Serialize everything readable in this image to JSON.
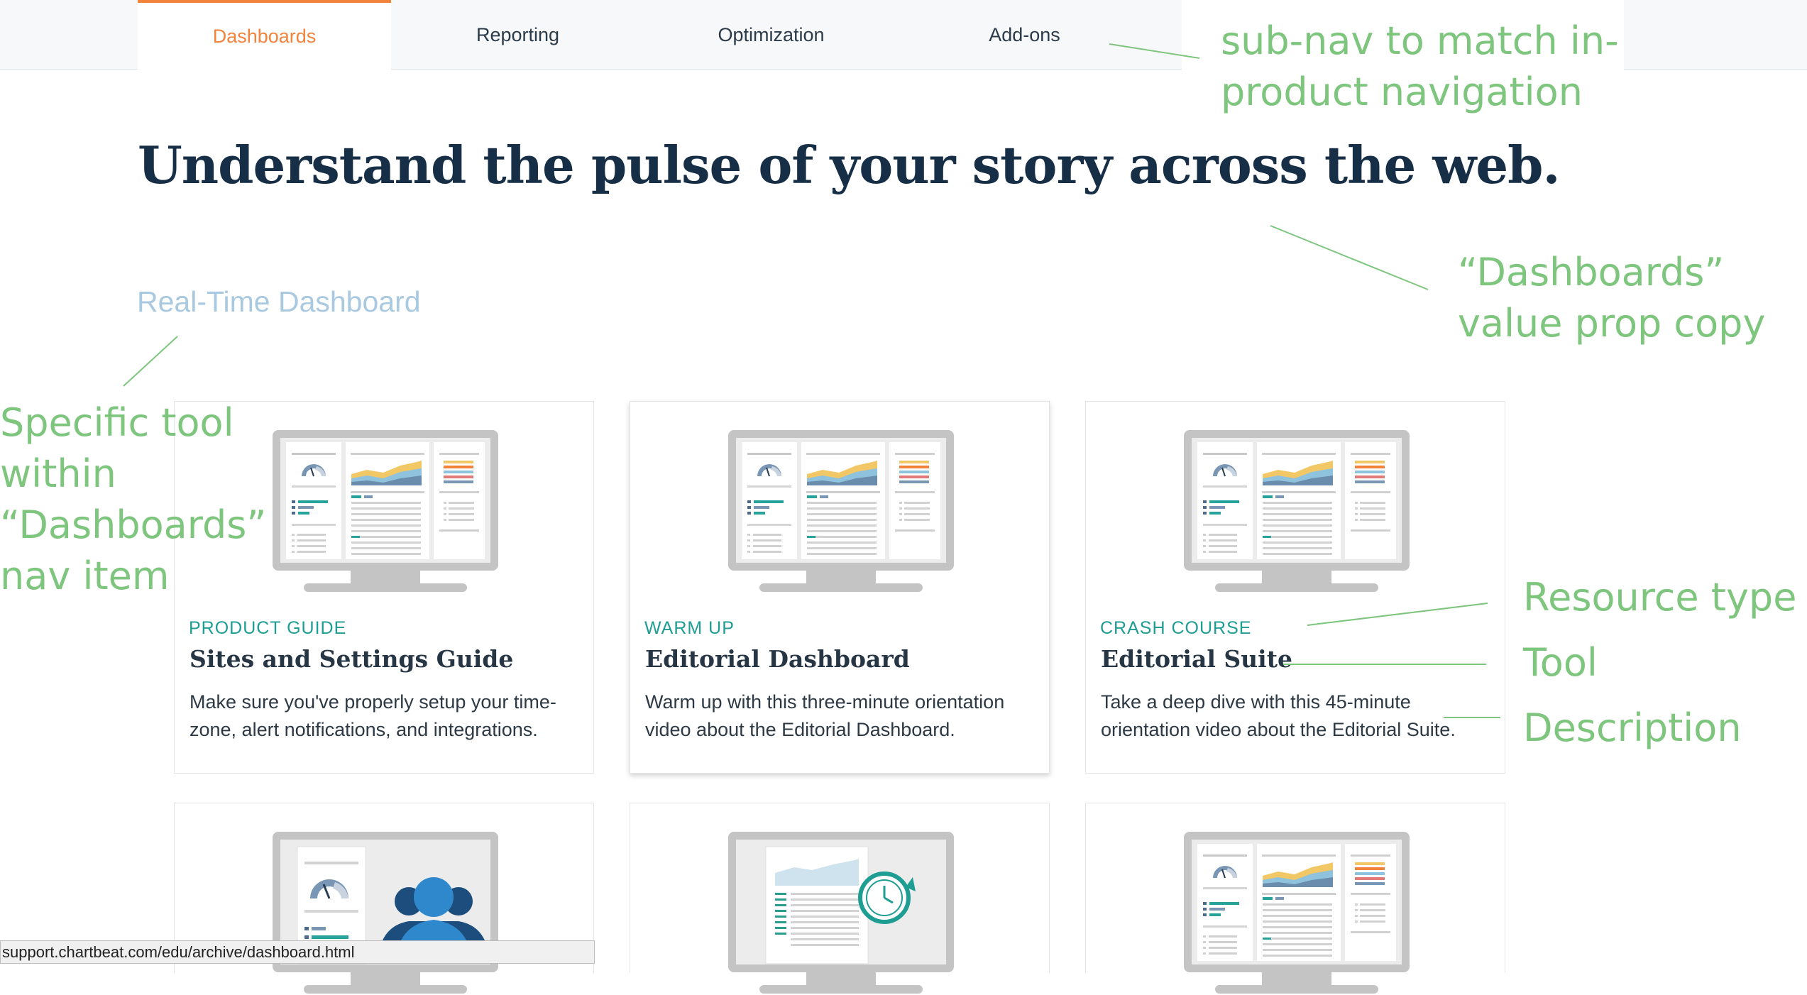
{
  "subnav": {
    "tabs": [
      {
        "label": "Dashboards",
        "active": true
      },
      {
        "label": "Reporting",
        "active": false
      },
      {
        "label": "Optimization",
        "active": false
      },
      {
        "label": "Add-ons",
        "active": false
      }
    ]
  },
  "main": {
    "headline": "Understand the pulse of your story across the web.",
    "tool_label": "Real-Time Dashboard"
  },
  "cards": [
    {
      "type": "PRODUCT GUIDE",
      "title": "Sites and Settings Guide",
      "desc": "Make sure you've properly setup your time-zone, alert notifications, and integrations.",
      "illustration": "monitor-dashboard-icon"
    },
    {
      "type": "WARM UP",
      "title": "Editorial Dashboard",
      "desc": "Warm up with this three-minute orientation video about the Editorial Dashboard.",
      "illustration": "monitor-dashboard-icon"
    },
    {
      "type": "CRASH COURSE",
      "title": "Editorial Suite",
      "desc": "Take a deep dive with this 45-minute orientation video about the Editorial Suite.",
      "illustration": "monitor-dashboard-icon"
    }
  ],
  "cards_row2": [
    {
      "illustration": "monitor-team-icon"
    },
    {
      "illustration": "monitor-clock-report-icon"
    },
    {
      "illustration": "monitor-dashboard-icon"
    }
  ],
  "annotations": {
    "subnav": "sub-nav to match in-\nproduct navigation",
    "value_prop": "“Dashboards”\nvalue prop copy",
    "specific_tool": "Specific tool\nwithin\n“Dashboards”\nnav item",
    "resource_type": "Resource type",
    "tool": "Tool",
    "description": "Description"
  },
  "statusbar": {
    "url": "support.chartbeat.com/edu/archive/dashboard.html"
  },
  "colors": {
    "accent": "#f3823a",
    "teal": "#1e9d93",
    "navy": "#172e47",
    "annotation": "#7ec57e",
    "tool_label": "#a9c9e1"
  }
}
